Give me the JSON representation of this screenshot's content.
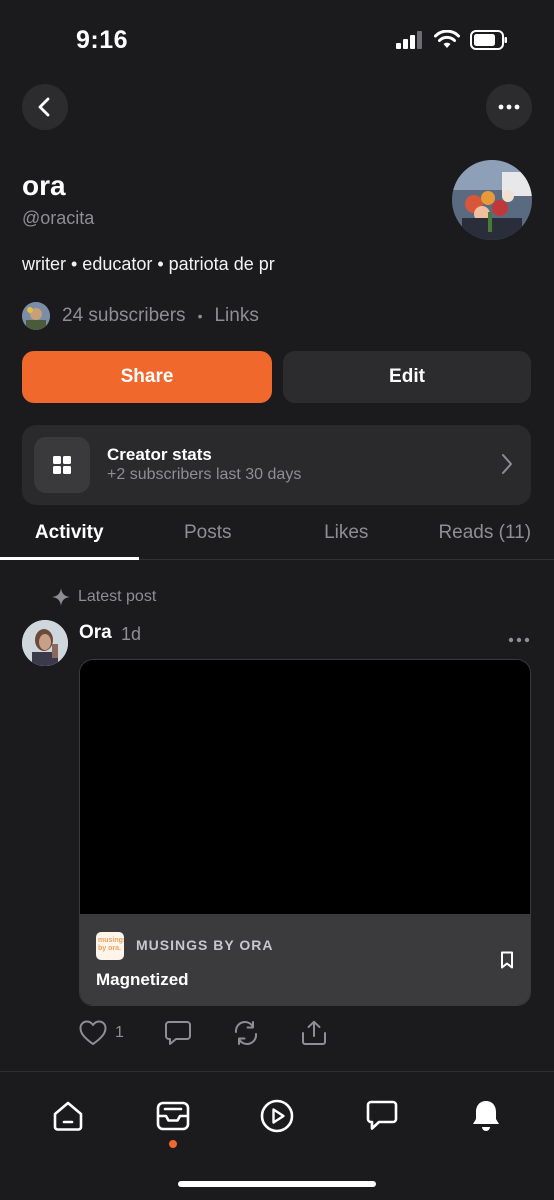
{
  "status_bar": {
    "time": "9:16"
  },
  "profile": {
    "name": "ora",
    "handle": "@oracita",
    "bio": "writer • educator • patriota de pr",
    "subscribers": "24 subscribers",
    "links": "Links"
  },
  "actions": {
    "share": "Share",
    "edit": "Edit"
  },
  "creator_stats": {
    "title": "Creator stats",
    "subtitle": "+2 subscribers last 30 days"
  },
  "tabs": [
    {
      "label": "Activity",
      "active": true
    },
    {
      "label": "Posts",
      "active": false
    },
    {
      "label": "Likes",
      "active": false
    },
    {
      "label": "Reads (11)",
      "active": false
    }
  ],
  "feed": {
    "section_label": "Latest post",
    "post": {
      "author": "Ora",
      "time": "1d",
      "publication": "MUSINGS BY ORA",
      "logo_text": "musings by ora.",
      "title": "Magnetized",
      "likes": "1"
    }
  },
  "colors": {
    "accent": "#f0682c",
    "background": "#1b1b1d",
    "card": "#2a2a2c",
    "muted_text": "#8e8e93"
  },
  "icons": {
    "nav": [
      "home-icon",
      "inbox-icon",
      "play-icon",
      "chat-icon",
      "bell-icon"
    ],
    "nav_active_dot": "inbox"
  }
}
